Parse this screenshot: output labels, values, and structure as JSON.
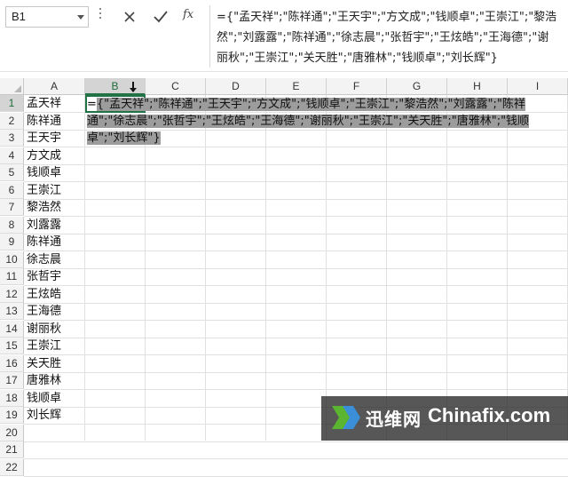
{
  "formula_bar": {
    "name_box": "B1",
    "cancel_icon": "close-icon",
    "enter_icon": "check-icon",
    "fx_label": "fx",
    "formula": "={\"孟天祥\";\"陈祥通\";\"王天宇\";\"方文成\";\"钱顺卓\";\"王崇江\";\"黎浩然\";\"刘露露\";\"陈祥通\";\"徐志晨\";\"张哲宇\";\"王炫皓\";\"王海德\";\"谢丽秋\";\"王崇江\";\"关天胜\";\"唐雅林\";\"钱顺卓\";\"刘长辉\"}"
  },
  "grid": {
    "columns": [
      "A",
      "B",
      "C",
      "D",
      "E",
      "F",
      "G",
      "H",
      "I"
    ],
    "selected_column": "B",
    "selected_row": "1",
    "rows": [
      "1",
      "2",
      "3",
      "4",
      "5",
      "6",
      "7",
      "8",
      "9",
      "10",
      "11",
      "12",
      "13",
      "14",
      "15",
      "16",
      "17",
      "18",
      "19",
      "20",
      "21",
      "22"
    ],
    "column_a": [
      "孟天祥",
      "陈祥通",
      "王天宇",
      "方文成",
      "钱顺卓",
      "王崇江",
      "黎浩然",
      "刘露露",
      "陈祥通",
      "徐志晨",
      "张哲宇",
      "王炫皓",
      "王海德",
      "谢丽秋",
      "王崇江",
      "关天胜",
      "唐雅林",
      "钱顺卓",
      "刘长辉"
    ],
    "edit_prefix": "=",
    "edit_highlight": "{\"孟天祥\";\"陈祥通\";\"王天宇\";\"方文成\";\"钱顺卓\";\"王崇江\";\"黎浩然\";\"刘露露\";\"陈祥通\";\"徐志晨\";\"张哲宇\";\"王炫皓\";\"王海德\";\"谢丽秋\";\"王崇江\";\"关天胜\";\"唐雅林\";\"钱顺卓\";\"刘长辉\"}"
  },
  "watermark": {
    "brand_cn": "迅维网",
    "brand_en": "Chinafix.com"
  },
  "colors": {
    "selection": "#217346",
    "header_bg": "#f3f3f3",
    "highlight": "#9c9c9c"
  }
}
